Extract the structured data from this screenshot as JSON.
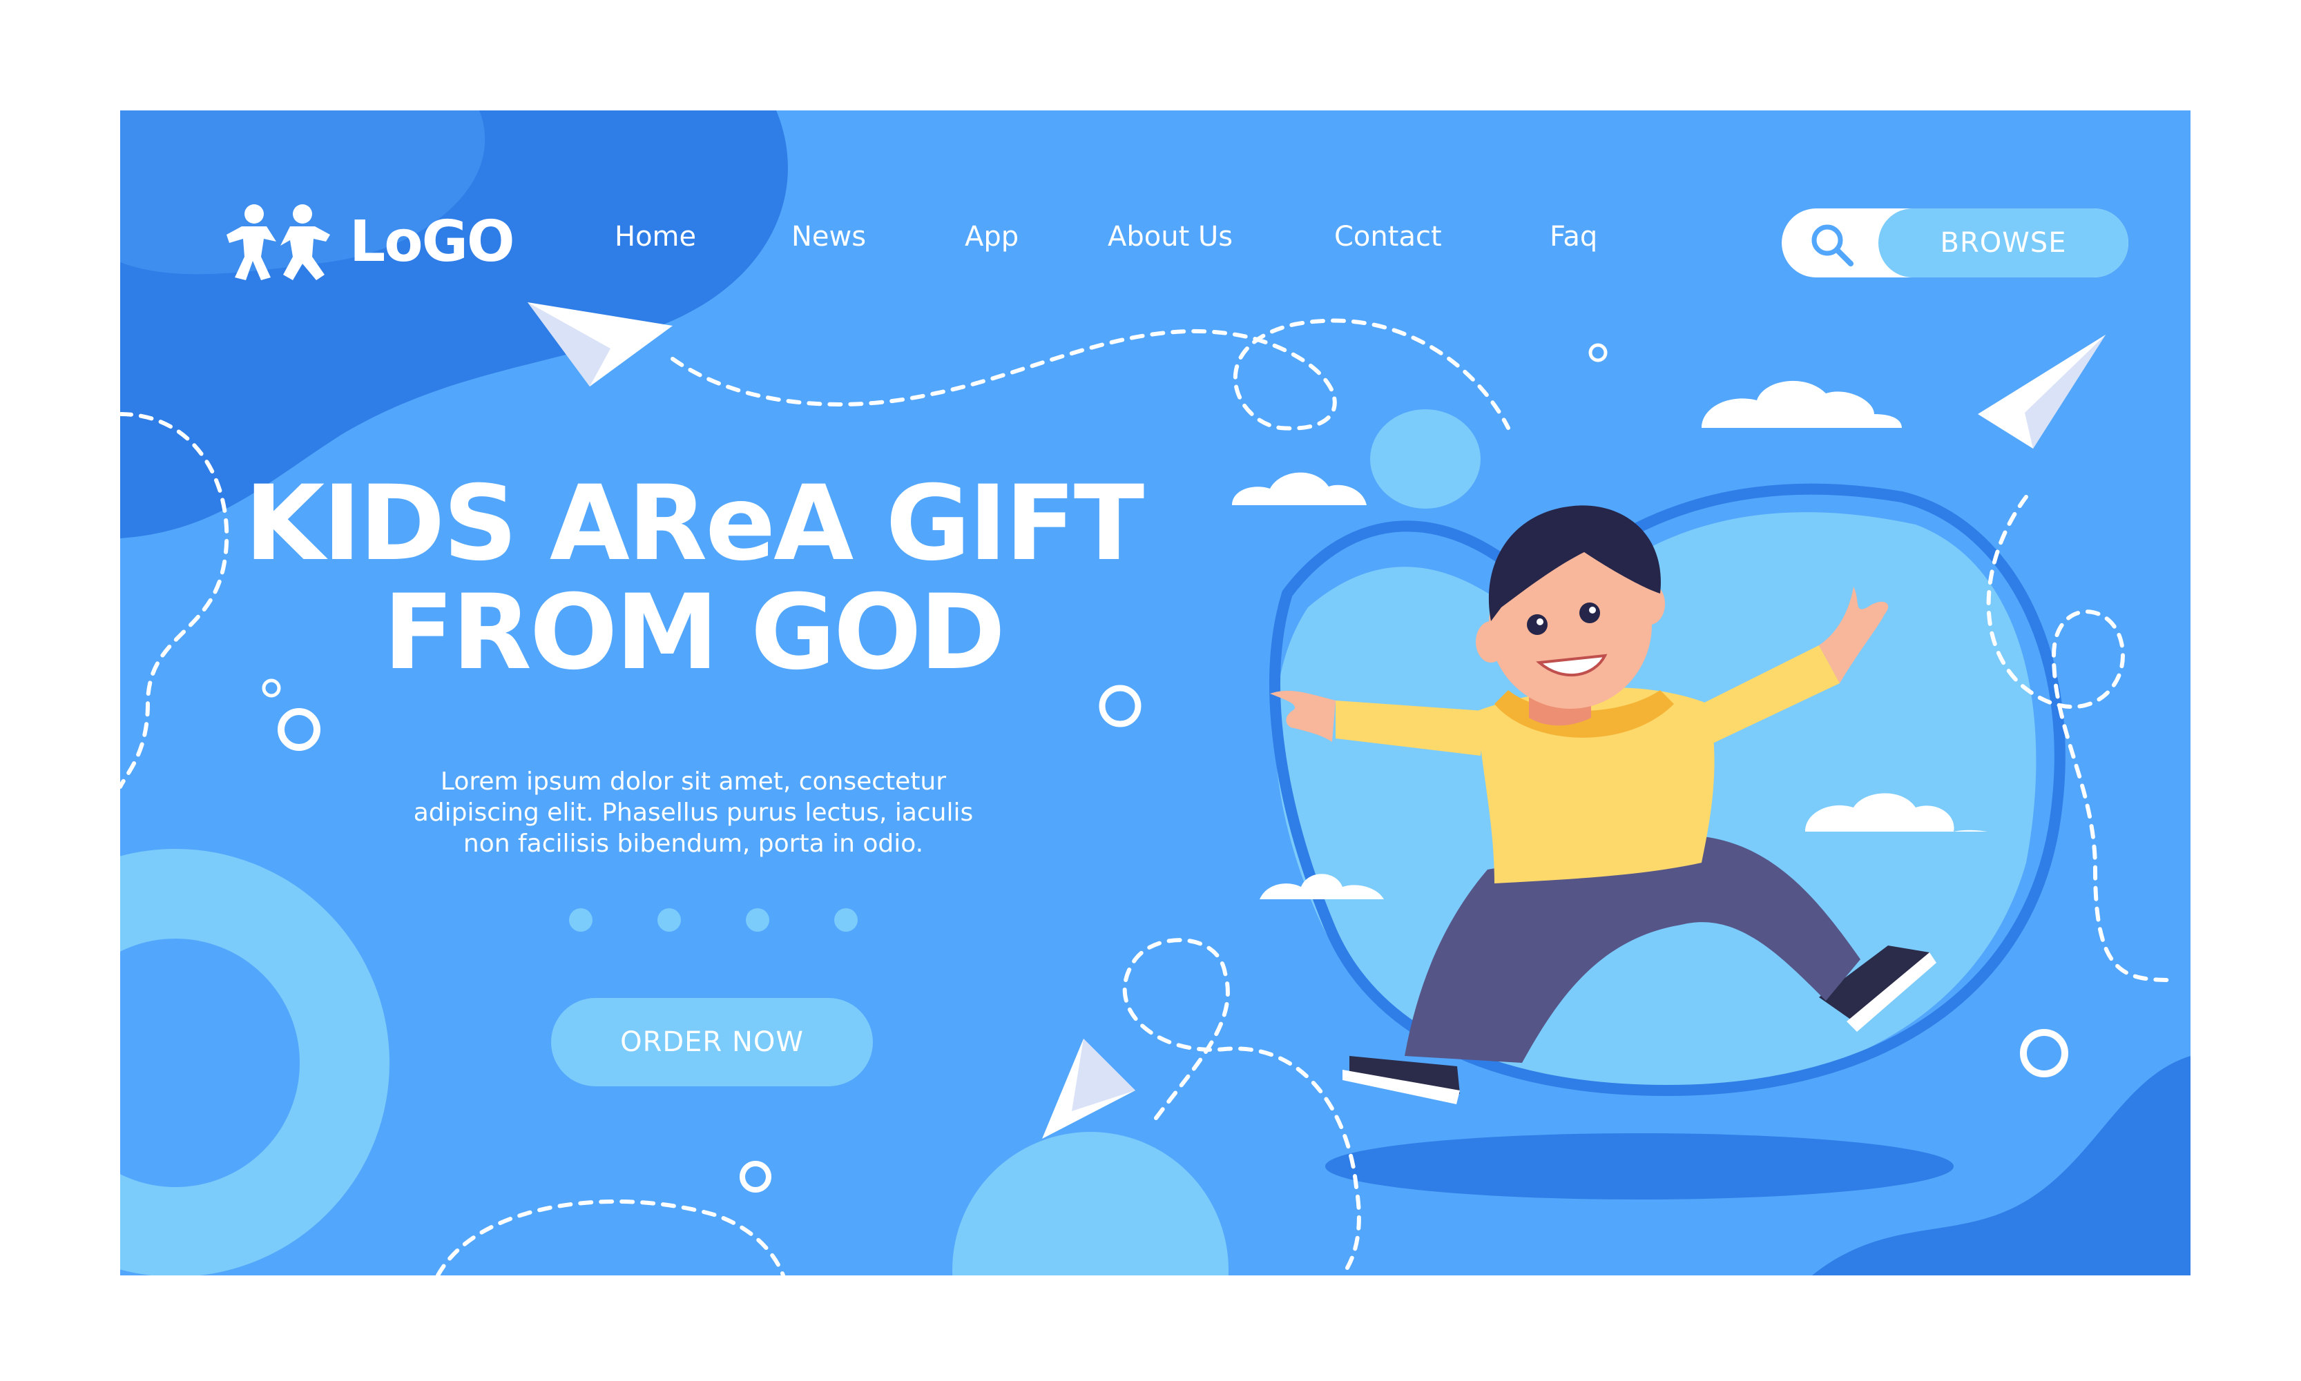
{
  "logo": {
    "text": "LoGO",
    "icon": "two-kids-icon"
  },
  "nav": {
    "items": [
      "Home",
      "News",
      "App",
      "About Us",
      "Contact",
      "Faq"
    ]
  },
  "search": {
    "icon": "search-icon",
    "button_label": "BROWSE"
  },
  "hero": {
    "title_line1": "KIDS AReA GIFT",
    "title_line2": "FROM GOD",
    "description_line1": "Lorem ipsum dolor sit amet, consectetur",
    "description_line2": "adipiscing elit. Phasellus purus lectus, iaculis",
    "description_line3": "non facilisis bibendum, porta in odio.",
    "cta_label": "ORDER NOW",
    "slider_dots": 4
  },
  "colors": {
    "background": "#52a6fb",
    "dark_blue": "#2f7de6",
    "light_blue": "#7bcbfb",
    "white": "#ffffff",
    "shirt_yellow": "#fdd86b",
    "pants_purple": "#555587"
  }
}
